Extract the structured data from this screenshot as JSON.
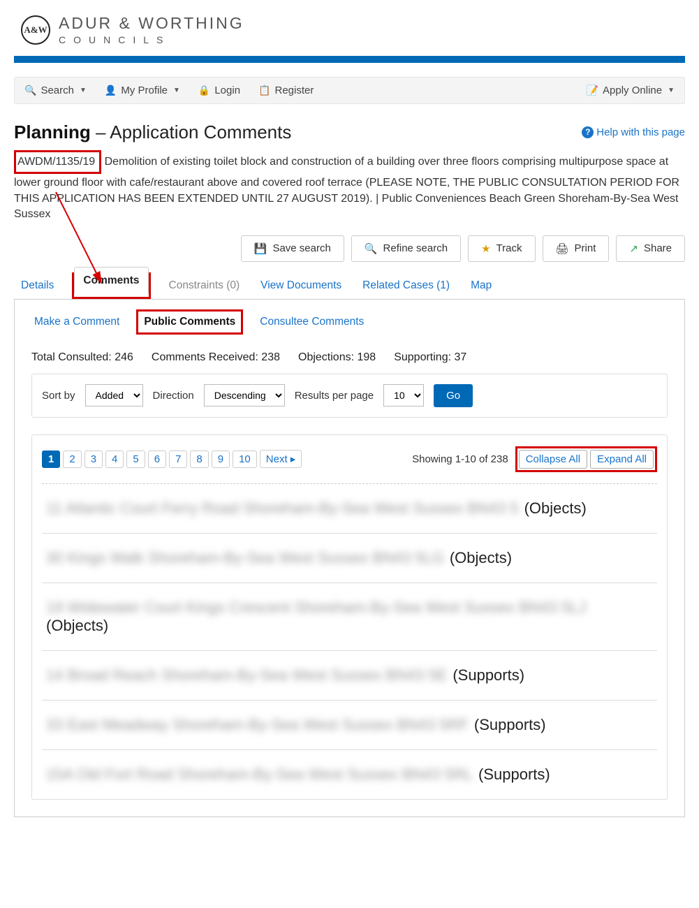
{
  "logo": {
    "badge": "A&W",
    "main": "ADUR & WORTHING",
    "sub": "COUNCILS"
  },
  "toolbar": {
    "search": "Search",
    "profile": "My Profile",
    "login": "Login",
    "register": "Register",
    "apply": "Apply Online"
  },
  "title": {
    "bold": "Planning",
    "rest": " – Application Comments",
    "help": "Help with this page"
  },
  "reference": "AWDM/1135/19",
  "description": "Demolition of existing toilet block and construction of a building over three floors comprising multipurpose space at lower ground floor with cafe/restaurant above and covered roof terrace (PLEASE NOTE, THE PUBLIC CONSULTATION PERIOD FOR THIS APPLICATION HAS BEEN EXTENDED UNTIL 27 AUGUST 2019). | Public Conveniences Beach Green Shoreham-By-Sea West Sussex",
  "actions": {
    "save": "Save search",
    "refine": "Refine search",
    "track": "Track",
    "print": "Print",
    "share": "Share"
  },
  "main_tabs": {
    "details": "Details",
    "comments": "Comments",
    "constraints": "Constraints (0)",
    "documents": "View Documents",
    "related": "Related Cases (1)",
    "map": "Map"
  },
  "sub_tabs": {
    "make": "Make a Comment",
    "public": "Public Comments",
    "consultee": "Consultee Comments"
  },
  "counts": {
    "consulted_label": "Total Consulted:",
    "consulted": "246",
    "received_label": "Comments Received:",
    "received": "238",
    "objections_label": "Objections:",
    "objections": "198",
    "supporting_label": "Supporting:",
    "supporting": "37"
  },
  "sort": {
    "sortby_label": "Sort by",
    "sortby": "Added",
    "direction_label": "Direction",
    "direction": "Descending",
    "rpp_label": "Results per page",
    "rpp": "10",
    "go": "Go"
  },
  "pager": {
    "pages": [
      "1",
      "2",
      "3",
      "4",
      "5",
      "6",
      "7",
      "8",
      "9",
      "10"
    ],
    "next": "Next",
    "showing": "Showing 1-10 of 238",
    "collapse": "Collapse All",
    "expand": "Expand All"
  },
  "results": [
    {
      "redacted": "11 Atlantic Court Ferry Road Shoreham-By-Sea West Sussex BN43 5",
      "status": "(Objects)"
    },
    {
      "redacted": "30 Kings Walk Shoreham-By-Sea West Sussex BN43 5LG",
      "status": "(Objects)"
    },
    {
      "redacted": "19 Widewater Court Kings Crescent Shoreham-By-Sea West Sussex BN43 5LJ",
      "status": "(Objects)",
      "wrap": true
    },
    {
      "redacted": "14 Broad Reach Shoreham-By-Sea West Sussex BN43 5E",
      "status": "(Supports)"
    },
    {
      "redacted": "33 East Meadway Shoreham-By-Sea West Sussex BN43 5RF",
      "status": "(Supports)"
    },
    {
      "redacted": "15A Old Fort Road Shoreham-By-Sea West Sussex BN43 5RL",
      "status": "(Supports)"
    }
  ]
}
